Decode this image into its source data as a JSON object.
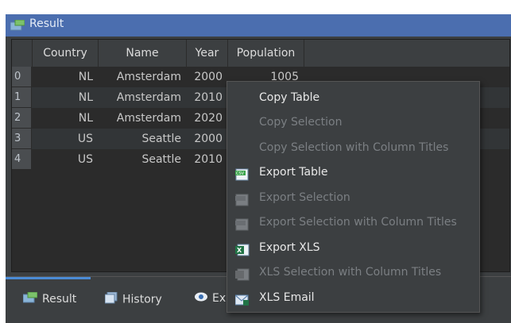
{
  "panel": {
    "title": "Result",
    "title_icon": "result-table-icon"
  },
  "table": {
    "columns": [
      "Country",
      "Name",
      "Year",
      "Population"
    ],
    "rows": [
      {
        "index": "0",
        "country": "NL",
        "name": "Amsterdam",
        "year": "2000",
        "population": "1005"
      },
      {
        "index": "1",
        "country": "NL",
        "name": "Amsterdam",
        "year": "2010",
        "population": ""
      },
      {
        "index": "2",
        "country": "NL",
        "name": "Amsterdam",
        "year": "2020",
        "population": ""
      },
      {
        "index": "3",
        "country": "US",
        "name": "Seattle",
        "year": "2000",
        "population": ""
      },
      {
        "index": "4",
        "country": "US",
        "name": "Seattle",
        "year": "2010",
        "population": ""
      }
    ]
  },
  "bottom_tabs": [
    {
      "label": "Result",
      "icon": "result-table-icon",
      "active": true
    },
    {
      "label": "History",
      "icon": "history-icon",
      "active": false
    },
    {
      "label": "Ex",
      "icon": "eye-icon",
      "active": false
    }
  ],
  "context_menu": {
    "items": [
      {
        "label": "Copy Table",
        "enabled": true,
        "icon": ""
      },
      {
        "label": "Copy Selection",
        "enabled": false,
        "icon": ""
      },
      {
        "label": "Copy Selection with Column Titles",
        "enabled": false,
        "icon": ""
      },
      {
        "label": "Export Table",
        "enabled": true,
        "icon": "csv-export-icon"
      },
      {
        "label": "Export Selection",
        "enabled": false,
        "icon": "csv-export-icon"
      },
      {
        "label": "Export Selection with Column Titles",
        "enabled": false,
        "icon": "csv-export-icon"
      },
      {
        "label": "Export XLS",
        "enabled": true,
        "icon": "xls-export-icon"
      },
      {
        "label": "XLS Selection with Column Titles",
        "enabled": false,
        "icon": "xls-export-icon"
      },
      {
        "label": "XLS Email",
        "enabled": true,
        "icon": "email-icon"
      }
    ]
  },
  "colors": {
    "accent": "#4b6eaf",
    "panel_bg": "#3c3f41",
    "grid_bg": "#2b2b2b",
    "tab_indicator": "#4b8bd6"
  }
}
